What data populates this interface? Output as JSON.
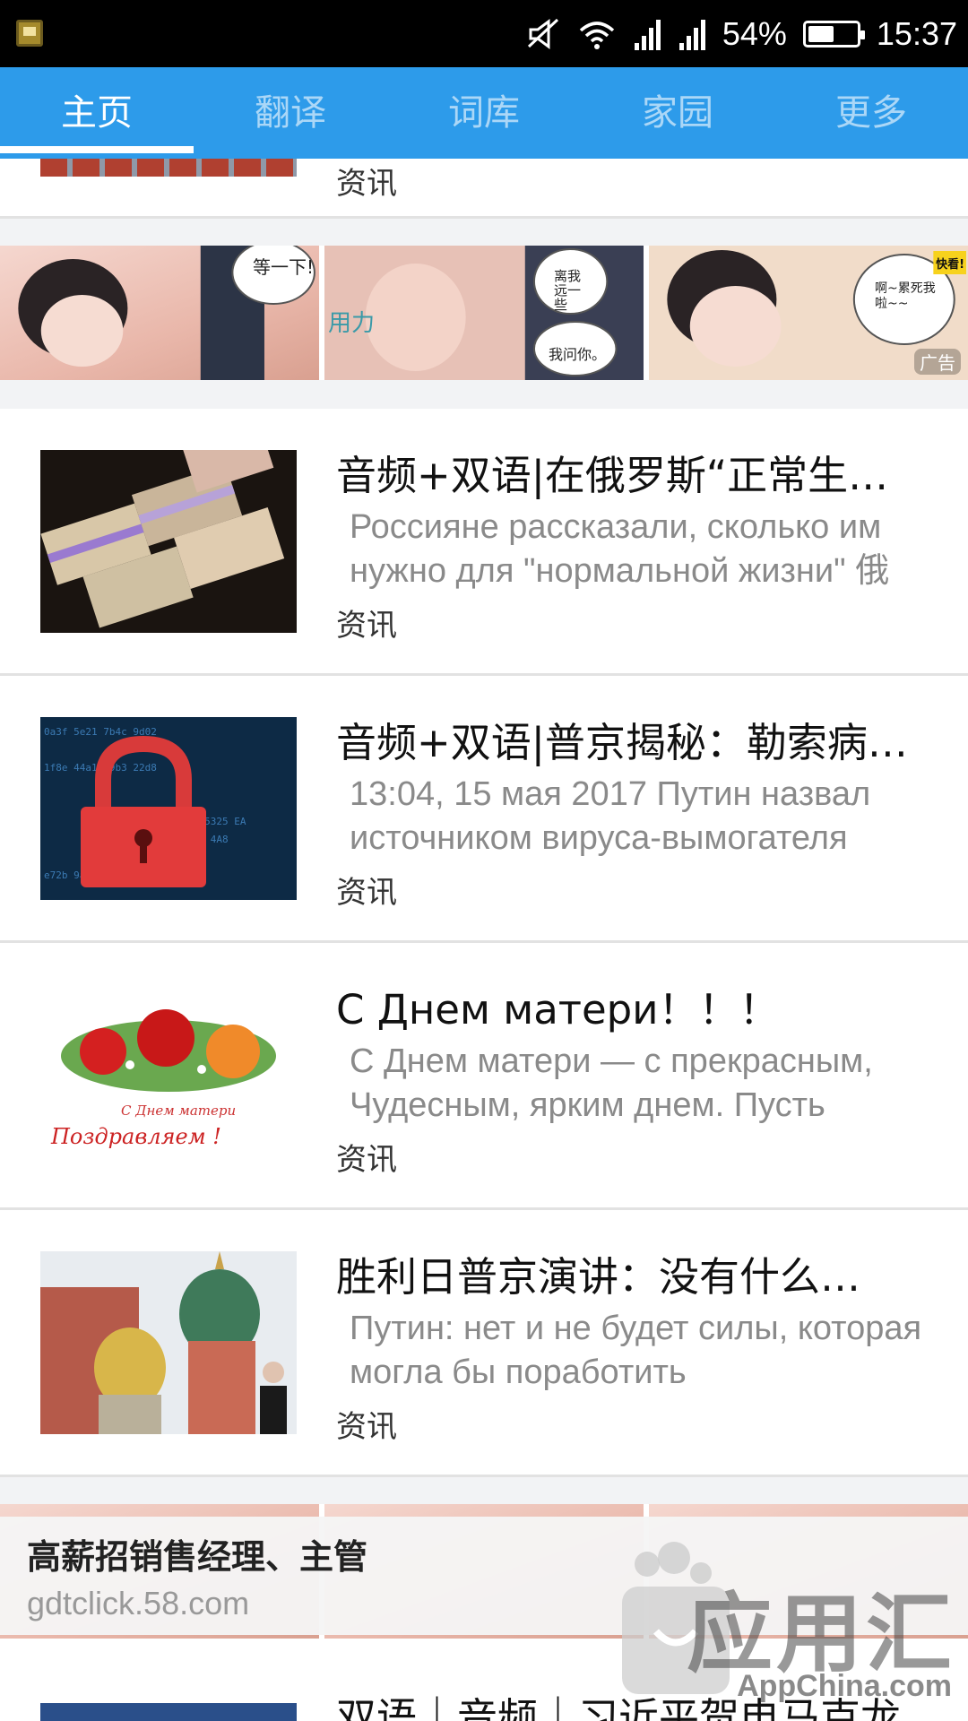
{
  "status_bar": {
    "battery": "54%",
    "battery_level": 0.54,
    "time": "15:37",
    "icons": [
      "app-notification-icon",
      "mute-icon",
      "wifi-icon",
      "cellular-signal-icon",
      "cellular-signal-icon",
      "battery-icon"
    ]
  },
  "tabs": [
    {
      "label": "主页",
      "active": true
    },
    {
      "label": "翻译",
      "active": false
    },
    {
      "label": "词库",
      "active": false
    },
    {
      "label": "家园",
      "active": false
    },
    {
      "label": "更多",
      "active": false
    }
  ],
  "accent_color": "#2d9bea",
  "partial_item": {
    "tag": "资讯"
  },
  "ad_strip": {
    "badge": "广告",
    "speech": [
      "等一下!",
      "离我远一些",
      "我问你。",
      "用力",
      "啊~累死我啦~~",
      "快看!"
    ]
  },
  "items": [
    {
      "title": "音频+双语|在俄罗斯“正常生…",
      "snippet": "Россияне рассказали, сколько им нужно для \"нормальной жизни\" 俄",
      "tag": "资讯",
      "thumb": "money-stacks-image"
    },
    {
      "title": "音频+双语|普京揭秘：勒索病…",
      "snippet": "13:04, 15 мая 2017 Путин назвал источником вируса-вымогателя",
      "tag": "资讯",
      "thumb": "red-padlock-image"
    },
    {
      "title": "С Днем матери！！！",
      "snippet": "С Днем матери — с прекрасным, Чудесным, ярким днем. Пусть",
      "tag": "资讯",
      "thumb": "roses-card-image",
      "thumb_caption": [
        "С Днем матери",
        "Поздравляем !"
      ]
    },
    {
      "title": "胜利日普京演讲：没有什么…",
      "snippet": "Путин: нет и не будет силы, которая могла бы  поработить",
      "tag": "资讯",
      "thumb": "kremlin-cathedral-image"
    }
  ],
  "partial_bottom_item": {
    "title": "双语｜音频｜习近平贺电马克龙"
  },
  "banner": {
    "title": "高薪招销售经理、主管",
    "url": "gdtclick.58.com"
  },
  "watermark": {
    "text": "应用汇",
    "sub": "AppChina.com"
  }
}
